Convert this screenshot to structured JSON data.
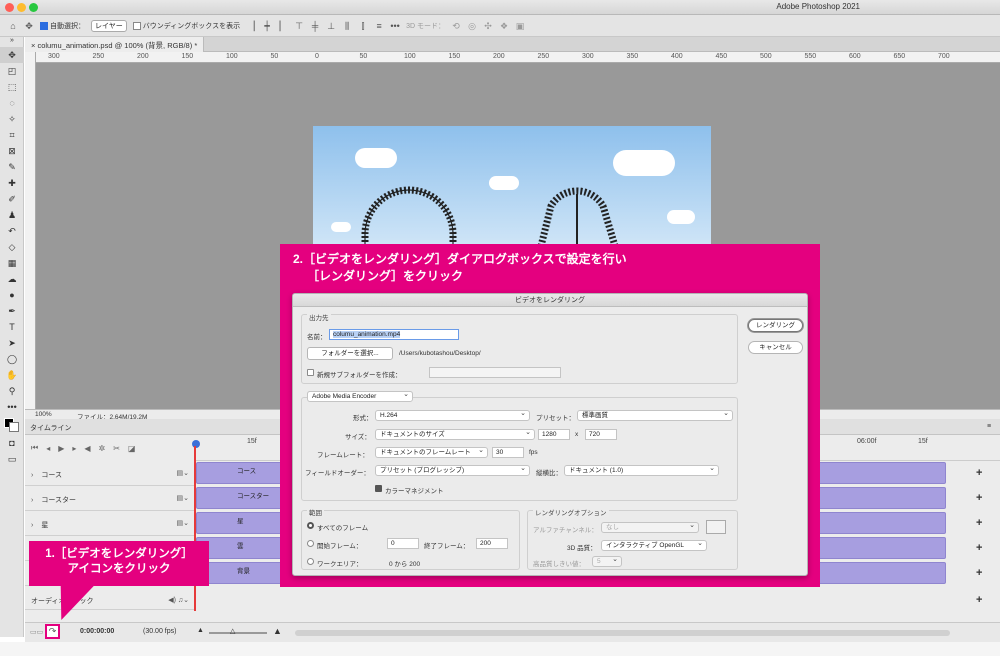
{
  "app_title": "Adobe Photoshop 2021",
  "options_bar": {
    "auto_select_label": "自動選択：",
    "auto_select_value": "レイヤー",
    "bounding_box_label": "バウンディングボックスを表示",
    "mode_3d_label": "3D モード："
  },
  "document": {
    "tab_title": "columu_animation.psd @ 100% (背景, RGB/8) *"
  },
  "ruler": {
    "marks": [
      "300",
      "250",
      "200",
      "150",
      "100",
      "50",
      "0",
      "50",
      "100",
      "150",
      "200",
      "250",
      "300",
      "350",
      "400",
      "450",
      "500",
      "550",
      "600",
      "650",
      "700"
    ]
  },
  "status": {
    "zoom": "100%",
    "file_info": "ファイル：2.64M/19.2M"
  },
  "timeline": {
    "panel_title": "タイムライン",
    "ruler_marks": [
      "15f",
      "06:00f",
      "15f"
    ],
    "tracks": [
      {
        "name": "コース",
        "bar_label": "コース"
      },
      {
        "name": "コースター",
        "bar_label": "コースター"
      },
      {
        "name": "星",
        "bar_label": "星"
      },
      {
        "name": "雲",
        "bar_label": "雲"
      },
      {
        "name": "背景",
        "bar_label": "背景"
      }
    ],
    "audio_track": "オーディオトラック",
    "timecode": "0:00:00:00",
    "fps": "(30.00 fps)"
  },
  "callout1": {
    "line1": "1.［ビデオをレンダリング］",
    "line2": "アイコンをクリック"
  },
  "callout2": {
    "line1": "2.［ビデオをレンダリング］ダイアログボックスで設定を行い",
    "line2": "［レンダリング］をクリック"
  },
  "dialog": {
    "title": "ビデオをレンダリング",
    "output_group": "出力先",
    "name_label": "名前：",
    "name_value": "columu_animation.mp4",
    "folder_button": "フォルダーを選択...",
    "folder_path": "/Users/kubotashou/Desktop/",
    "new_subfolder_label": "新規サブフォルダーを作成：",
    "render_button": "レンダリング",
    "cancel_button": "キャンセル",
    "encoder": "Adobe Media Encoder",
    "format_label": "形式：",
    "format_value": "H.264",
    "preset_label": "プリセット：",
    "preset_value": "標準画質",
    "size_label": "サイズ：",
    "size_value": "ドキュメントのサイズ",
    "width": "1280",
    "x_label": "x",
    "height": "720",
    "framerate_label": "フレームレート：",
    "framerate_value": "ドキュメントのフレームレート",
    "fps_value": "30",
    "fps_unit": "fps",
    "field_order_label": "フィールドオーダー：",
    "field_order_value": "プリセット (プログレッシブ)",
    "aspect_label": "縦横比：",
    "aspect_value": "ドキュメント (1.0)",
    "color_mgmt_label": "カラーマネジメント",
    "range_group": "範囲",
    "all_frames": "すべてのフレーム",
    "start_frame_label": "開始フレーム：",
    "start_frame_value": "0",
    "end_frame_label": "終了フレーム：",
    "end_frame_value": "200",
    "work_area_label": "ワークエリア：",
    "work_area_value": "0 から 200",
    "render_options_group": "レンダリングオプション",
    "alpha_label": "アルファチャンネル：",
    "alpha_value": "なし",
    "quality_3d_label": "3D 品質：",
    "quality_3d_value": "インタラクティブ OpenGL",
    "hq_threshold_label": "高品質しきい値：",
    "hq_threshold_value": "5"
  }
}
